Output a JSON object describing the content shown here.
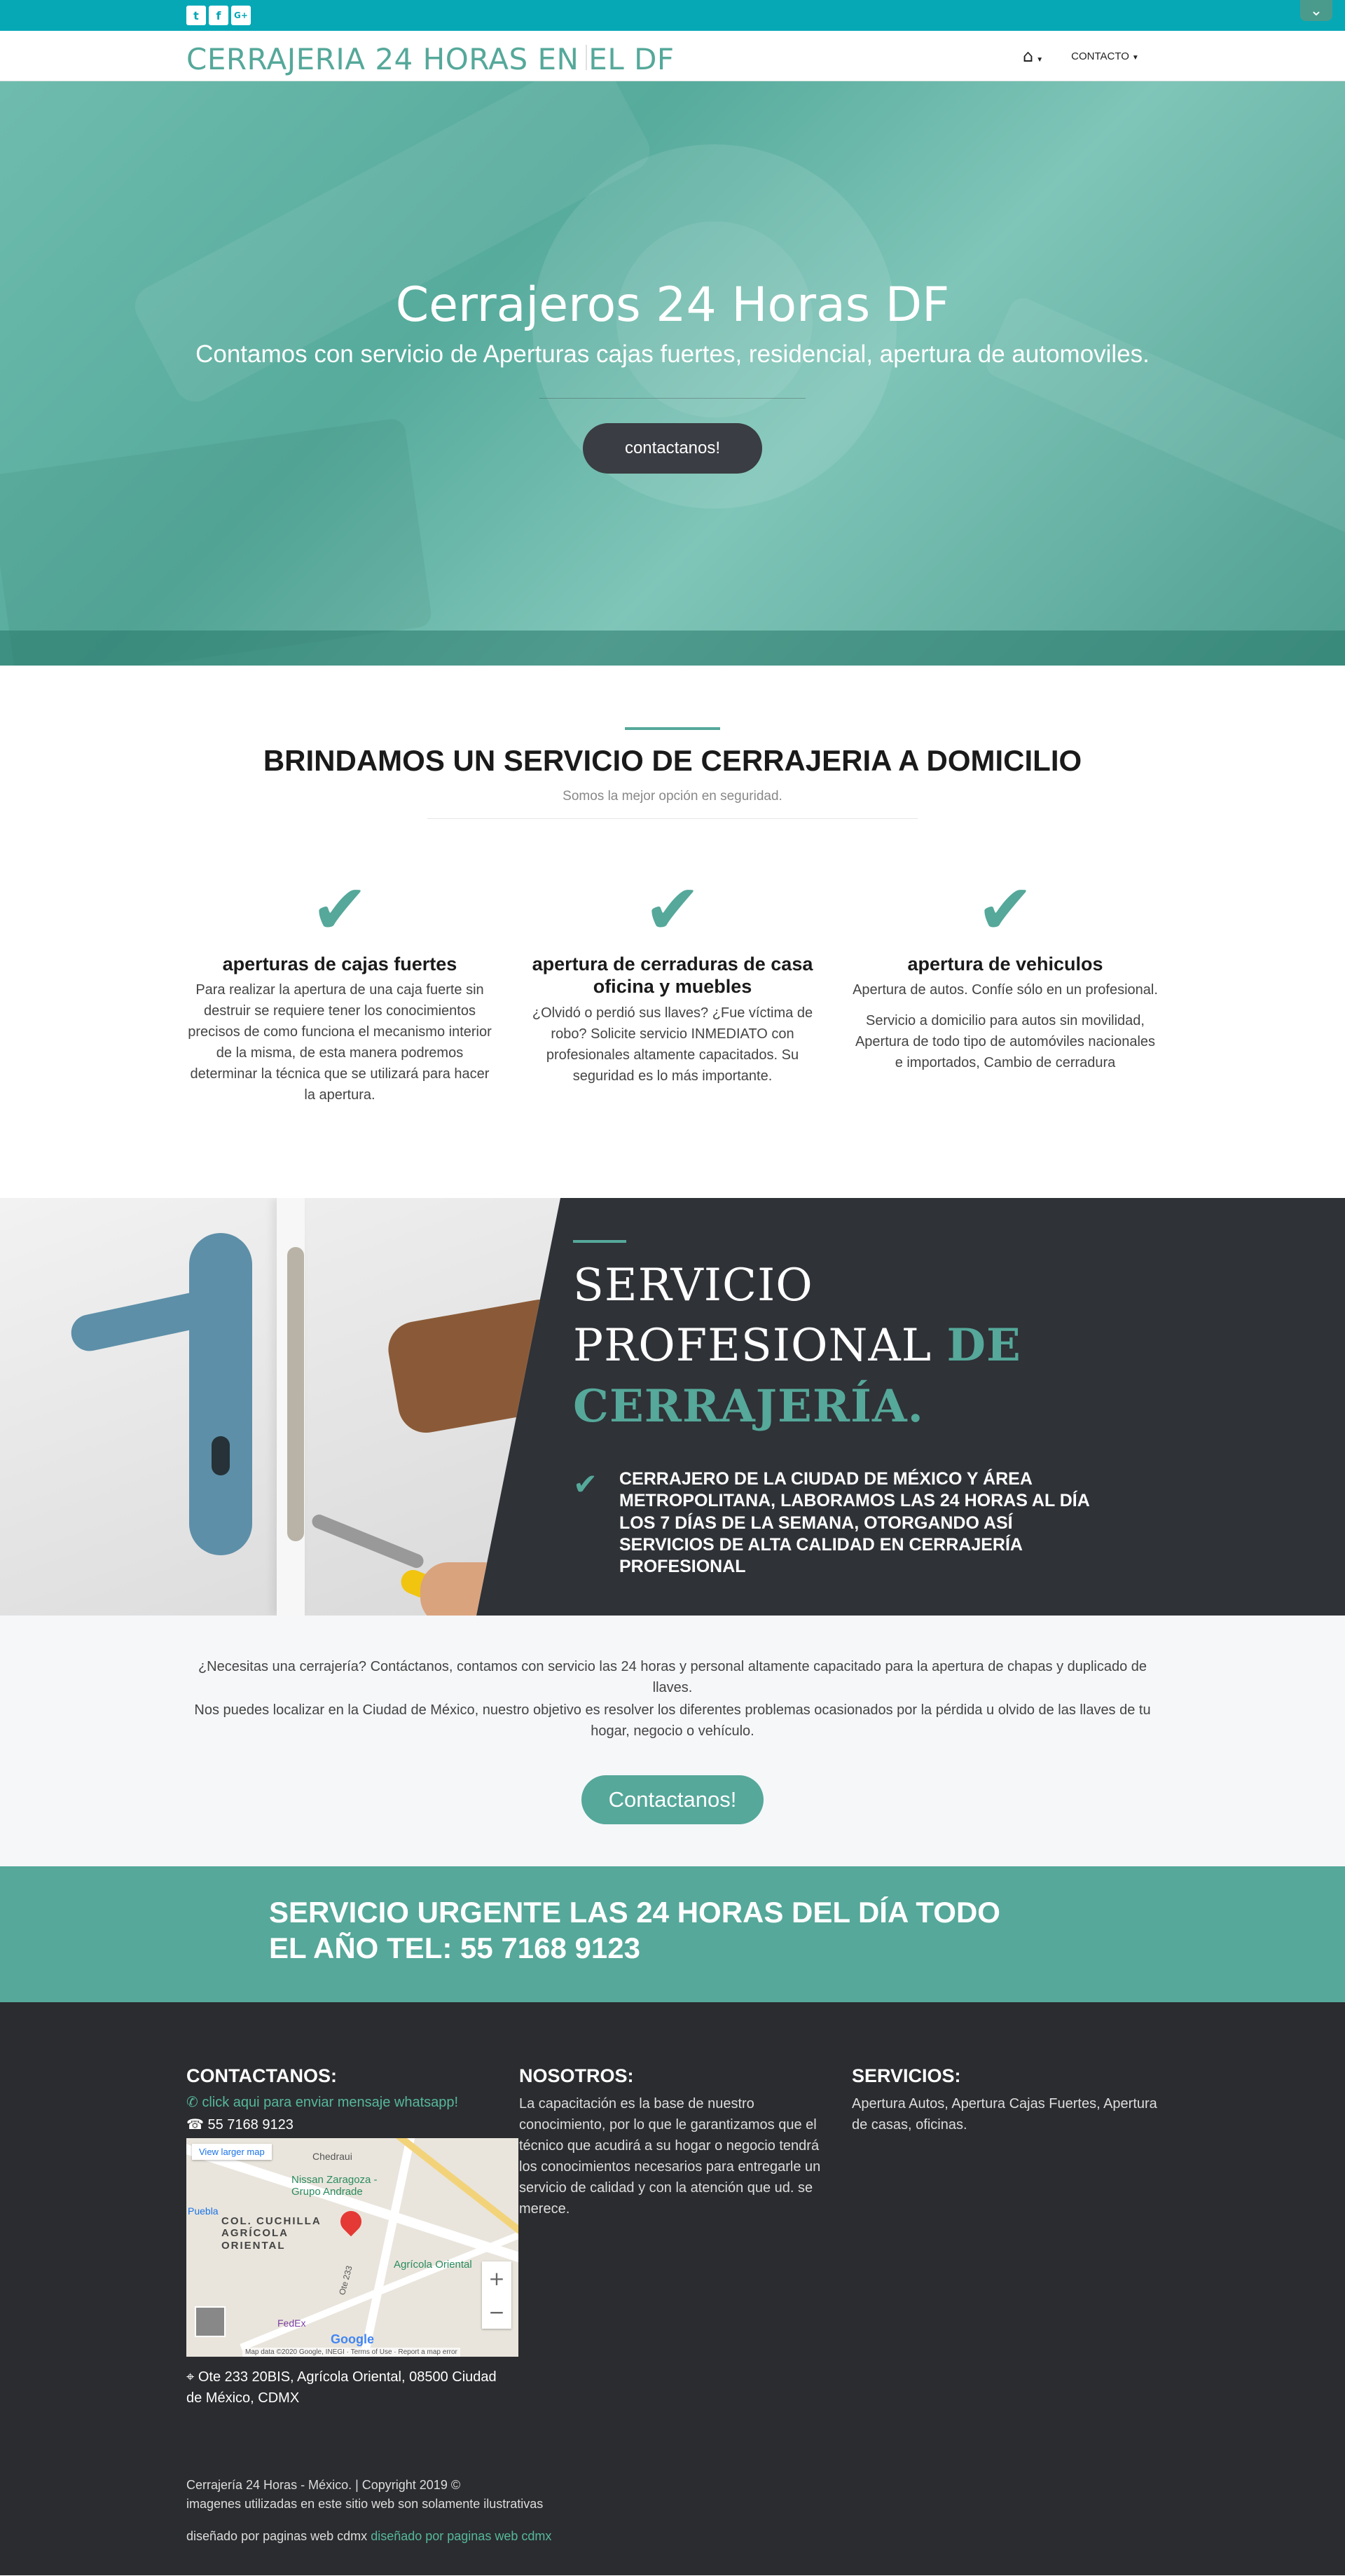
{
  "topbar": {
    "social": [
      {
        "icon": "twitter-icon",
        "glyph": "t"
      },
      {
        "icon": "facebook-icon",
        "glyph": "f"
      },
      {
        "icon": "google-plus-icon",
        "glyph": "G+"
      }
    ],
    "toggle_glyph": "⌄"
  },
  "nav": {
    "brand": "CERRAJERIA 24 HORAS EN EL DF",
    "home_glyph": "⌂",
    "contact_label": "CONTACTO"
  },
  "hero": {
    "title": "Cerrajeros 24 Horas DF",
    "subtitle": "Contamos con servicio de Aperturas cajas fuertes, residencial, apertura de automoviles.",
    "cta": "contactanos!"
  },
  "services": {
    "heading": "BRINDAMOS UN SERVICIO DE CERRAJERIA A DOMICILIO",
    "lead": "Somos la mejor opción en seguridad.",
    "items": [
      {
        "title": "aperturas de cajas fuertes",
        "text": "Para realizar la apertura de una caja fuerte sin destruir se requiere tener los conocimientos precisos de como funciona el mecanismo interior de la misma, de esta manera podremos determinar la técnica que se utilizará para hacer la apertura.",
        "text2": ""
      },
      {
        "title": "apertura de cerraduras de casa oficina y muebles",
        "text": "¿Olvidó o perdió sus llaves? ¿Fue víctima de robo? Solicite servicio INMEDIATO con profesionales altamente capacitados. Su seguridad es lo más importante.",
        "text2": ""
      },
      {
        "title": "apertura de vehiculos",
        "text": "Apertura de autos. Confíe sólo en un profesional.",
        "text2": "Servicio a domicilio para autos sin movilidad, Apertura de todo tipo de automóviles nacionales e importados, Cambio de cerradura"
      }
    ]
  },
  "pro": {
    "heading_plain": "SERVICIO PROFESIONAL ",
    "heading_accent": "DE CERRAJERÍA.",
    "text": "CERRAJERO DE LA CIUDAD DE MÉXICO Y ÁREA METROPOLITANA, LABORAMOS LAS 24 HORAS AL DÍA LOS 7 DÍAS DE LA SEMANA, OTORGANDO ASÍ SERVICIOS DE ALTA CALIDAD EN CERRAJERÍA PROFESIONAL"
  },
  "info": {
    "p1": "¿Necesitas una cerrajería? Contáctanos, contamos con servicio las 24 horas y personal altamente capacitado para la apertura de chapas y duplicado de llaves.",
    "p2": "Nos puedes localizar en la Ciudad de México, nuestro objetivo es resolver los diferentes problemas ocasionados por la pérdida u olvido de las llaves de tu hogar, negocio o vehículo.",
    "button": "Contactanos!"
  },
  "urgent": {
    "text": "SERVICIO URGENTE LAS 24 HORAS DEL DÍA TODO EL AÑO TEL: 55 7168 9123"
  },
  "footer": {
    "contact_heading": "CONTACTANOS:",
    "whatsapp": "click aqui para enviar mensaje whatsapp!",
    "phone": "55 7168 9123",
    "about_heading": "NOSOTROS:",
    "about_text": "La capacitación es la base de nuestro conocimiento, por lo que le garantizamos que el técnico que acudirá a su hogar o negocio tendrá los conocimientos necesarios para entregarle un servicio de calidad y con la atención que ud. se merece.",
    "services_heading": "SERVICIOS:",
    "services_text": "Apertura Autos, Apertura Cajas Fuertes, Apertura de casas, oficinas.",
    "address": "Ote 233 20BIS, Agrícola Oriental, 08500 Ciudad de México, CDMX",
    "copyright": "Cerrajería 24 Horas - México. | Copyright 2019 ©",
    "disclaimer": "imagenes utilizadas en este sitio web son solamente ilustrativas",
    "designed_prefix": "diseñado por paginas web cdmx",
    "designed_link": "diseñado por paginas web cdmx"
  },
  "map": {
    "larger_map": "View larger map",
    "labels": {
      "chedraui": "Chedraui",
      "nissan": "Nissan Zaragoza - Grupo Andrade",
      "puebla": "Puebla",
      "colonia": "COL. CUCHILLA AGRÍCOLA ORIENTAL",
      "agricola": "Agrícola Oriental",
      "fedex": "FedEx",
      "street": "Ote 233"
    },
    "attribution": "Map data ©2020 Google, INEGI · Terms of Use · Report a map error",
    "google": "Google",
    "zoom_in": "+",
    "zoom_out": "−"
  }
}
